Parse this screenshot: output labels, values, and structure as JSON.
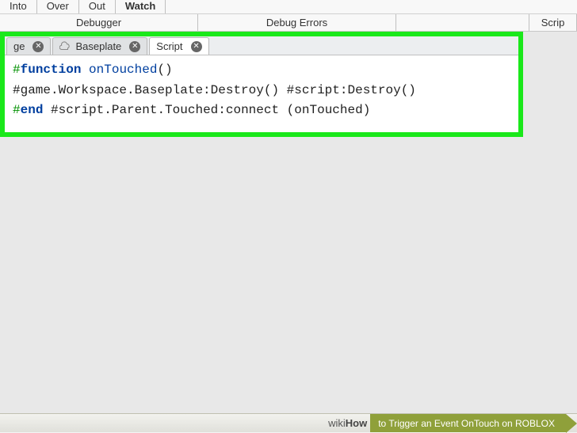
{
  "toolbar": {
    "items": [
      "Into",
      "Over",
      "Out",
      "Watch"
    ],
    "groups": {
      "debugger": "Debugger",
      "errors": "Debug Errors",
      "script": "Scrip"
    }
  },
  "tabs": [
    {
      "label": "ge",
      "active": false
    },
    {
      "label": "Baseplate",
      "active": false
    },
    {
      "label": "Script",
      "active": true
    }
  ],
  "code": {
    "line1": {
      "hash": "#",
      "keyword": "function",
      "space": " ",
      "name": "onTouched",
      "paren": "()"
    },
    "line2": {
      "t1": "#game.Workspace.Baseplate:Destroy()",
      "gap": " ",
      "t2": "#script:Destroy()"
    },
    "line3": {
      "hash": "#",
      "keyword": "end",
      "space": " ",
      "rest": "#script.Parent.Touched:connect (onTouched)"
    }
  },
  "wiki": {
    "brand": "wiki",
    "brand_bold": "How",
    "title": " to Trigger an Event OnTouch on ROBLOX"
  }
}
